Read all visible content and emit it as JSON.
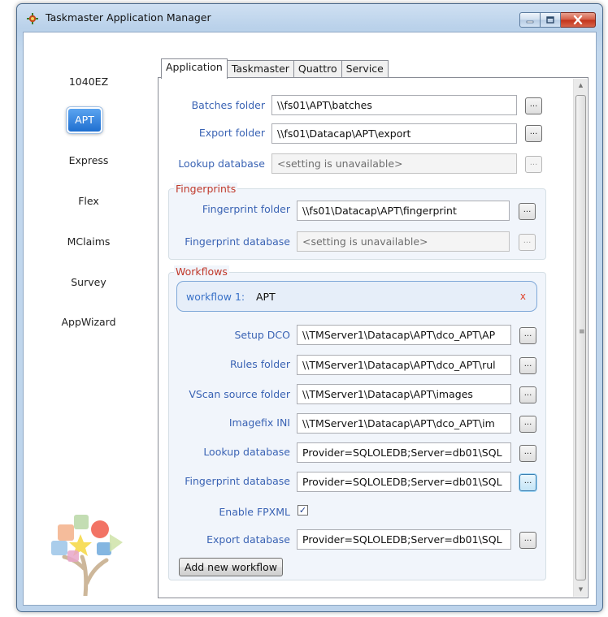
{
  "window": {
    "title": "Taskmaster Application Manager"
  },
  "apps": [
    "1040EZ",
    "APT",
    "Express",
    "Flex",
    "MClaims",
    "Survey",
    "AppWizard"
  ],
  "selected_app": "APT",
  "tabs": [
    "Application",
    "Taskmaster",
    "Quattro",
    "Service"
  ],
  "active_tab": "Application",
  "fields": {
    "batches_folder": {
      "label": "Batches folder",
      "value": "\\\\fs01\\APT\\batches"
    },
    "export_folder": {
      "label": "Export folder",
      "value": "\\\\fs01\\Datacap\\APT\\export"
    },
    "lookup_database": {
      "label": "Lookup database",
      "value": "<setting is unavailable>"
    }
  },
  "fingerprints": {
    "title": "Fingerprints",
    "folder": {
      "label": "Fingerprint folder",
      "value": "\\\\fs01\\Datacap\\APT\\fingerprint"
    },
    "database": {
      "label": "Fingerprint database",
      "value": "<setting is unavailable>"
    }
  },
  "workflows": {
    "title": "Workflows",
    "workflow_label": "workflow 1:",
    "workflow_name": "APT",
    "remove_glyph": "x",
    "setup_dco": {
      "label": "Setup DCO",
      "value": "\\\\TMServer1\\Datacap\\APT\\dco_APT\\AP"
    },
    "rules_folder": {
      "label": "Rules folder",
      "value": "\\\\TMServer1\\Datacap\\APT\\dco_APT\\rul"
    },
    "vscan_source": {
      "label": "VScan source folder",
      "value": "\\\\TMServer1\\Datacap\\APT\\images"
    },
    "imagefix_ini": {
      "label": "Imagefix INI",
      "value": "\\\\TMServer1\\Datacap\\APT\\dco_APT\\im"
    },
    "lookup_database": {
      "label": "Lookup database",
      "value": "Provider=SQLOLEDB;Server=db01\\SQL"
    },
    "fingerprint_database": {
      "label": "Fingerprint database",
      "value": "Provider=SQLOLEDB;Server=db01\\SQL"
    },
    "enable_fpxml": {
      "label": "Enable FPXML",
      "checked": true,
      "check_glyph": "✓"
    },
    "export_database": {
      "label": "Export database",
      "value": "Provider=SQLOLEDB;Server=db01\\SQL"
    },
    "add_button": "Add new workflow"
  },
  "browse_label": "...",
  "icons": {
    "app_icon": "taskmaster-gear-icon",
    "logo": "tree-logo-icon",
    "minimize": "minimize-icon",
    "maximize": "maximize-icon",
    "close": "close-icon"
  },
  "colors": {
    "label_blue": "#3a63b4",
    "group_title_red": "#c0392b",
    "selected_app_blue": "#1f6fd0",
    "remove_red": "#e0442d"
  }
}
